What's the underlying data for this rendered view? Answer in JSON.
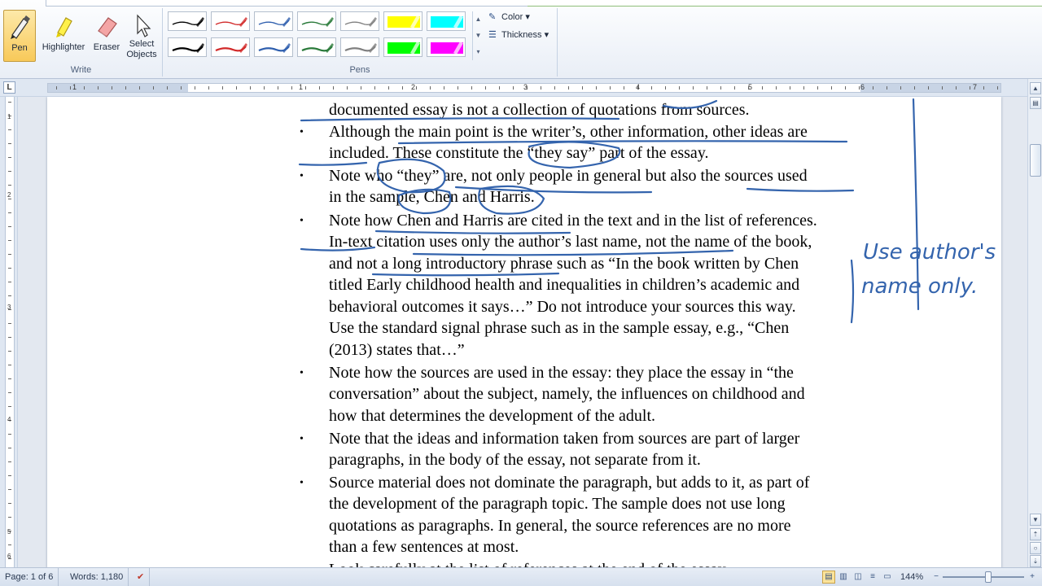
{
  "ribbon": {
    "write_group": {
      "label": "Write",
      "pen": "Pen",
      "highlighter": "Highlighter",
      "eraser": "Eraser",
      "select_objects_line1": "Select",
      "select_objects_line2": "Objects"
    },
    "pens_group": {
      "label": "Pens",
      "color_label": "Color",
      "thickness_label": "Thickness",
      "pen_colors": [
        "#000000",
        "#d22a2a",
        "#2f5fae",
        "#2a7a3a",
        "#808080",
        "#000000",
        "#d22a2a",
        "#2f5fae",
        "#2a7a3a",
        "#808080"
      ],
      "highlighter_colors": [
        "#ffff00",
        "#00ffff",
        "#00ff00",
        "#ff00ff"
      ]
    }
  },
  "ruler": {
    "corner": "L",
    "numbers": [
      "1",
      "1",
      "2",
      "3",
      "4",
      "5",
      "6",
      "7"
    ],
    "vertical_numbers": [
      "1",
      "2",
      "3",
      "4",
      "5",
      "6"
    ]
  },
  "document": {
    "lines": [
      "documented essay is not a collection of quotations from sources.",
      "Although the main point is the writer’s, other information, other ideas are",
      "included.  These constitute the “they say” part of the essay.",
      "Note who “they” are, not only people in general but also the sources used",
      "in the sample, Chen and Harris.",
      "Note how Chen and Harris are cited in the text and in the list of references.",
      "In-text citation uses only the author’s last name, not the name of the book,",
      "and not a long introductory phrase such as “In the book written by Chen",
      "titled Early childhood health and inequalities in children’s academic and",
      "behavioral outcomes it says…”  Do not introduce your sources this way.",
      "Use the standard signal phrase such as in the sample essay, e.g., “Chen",
      "(2013) states that…”",
      "Note how the sources are used in the essay: they place the essay in “the",
      "conversation” about the subject, namely, the influences on childhood and",
      "how that determines the development of the adult.",
      "Note that the ideas and information taken from sources are part of larger",
      "paragraphs, in the body of the essay, not separate from it.",
      "Source material does not dominate the paragraph, but adds to it, as part of",
      "the development of the paragraph topic.  The sample does not use long",
      "quotations as paragraphs.  In general, the source references are no more",
      "than a few sentences at most.",
      "Look carefully at the list of references at the end of the essay."
    ],
    "bullet_char": "•",
    "ink_color": "#3464ad",
    "handwritten_note_line1": "Use author's",
    "handwritten_note_line2": "name only."
  },
  "statusbar": {
    "page": "Page: 1 of 6",
    "words": "Words: 1,180",
    "zoom": "144%",
    "zoom_minus": "−",
    "zoom_plus": "+"
  }
}
